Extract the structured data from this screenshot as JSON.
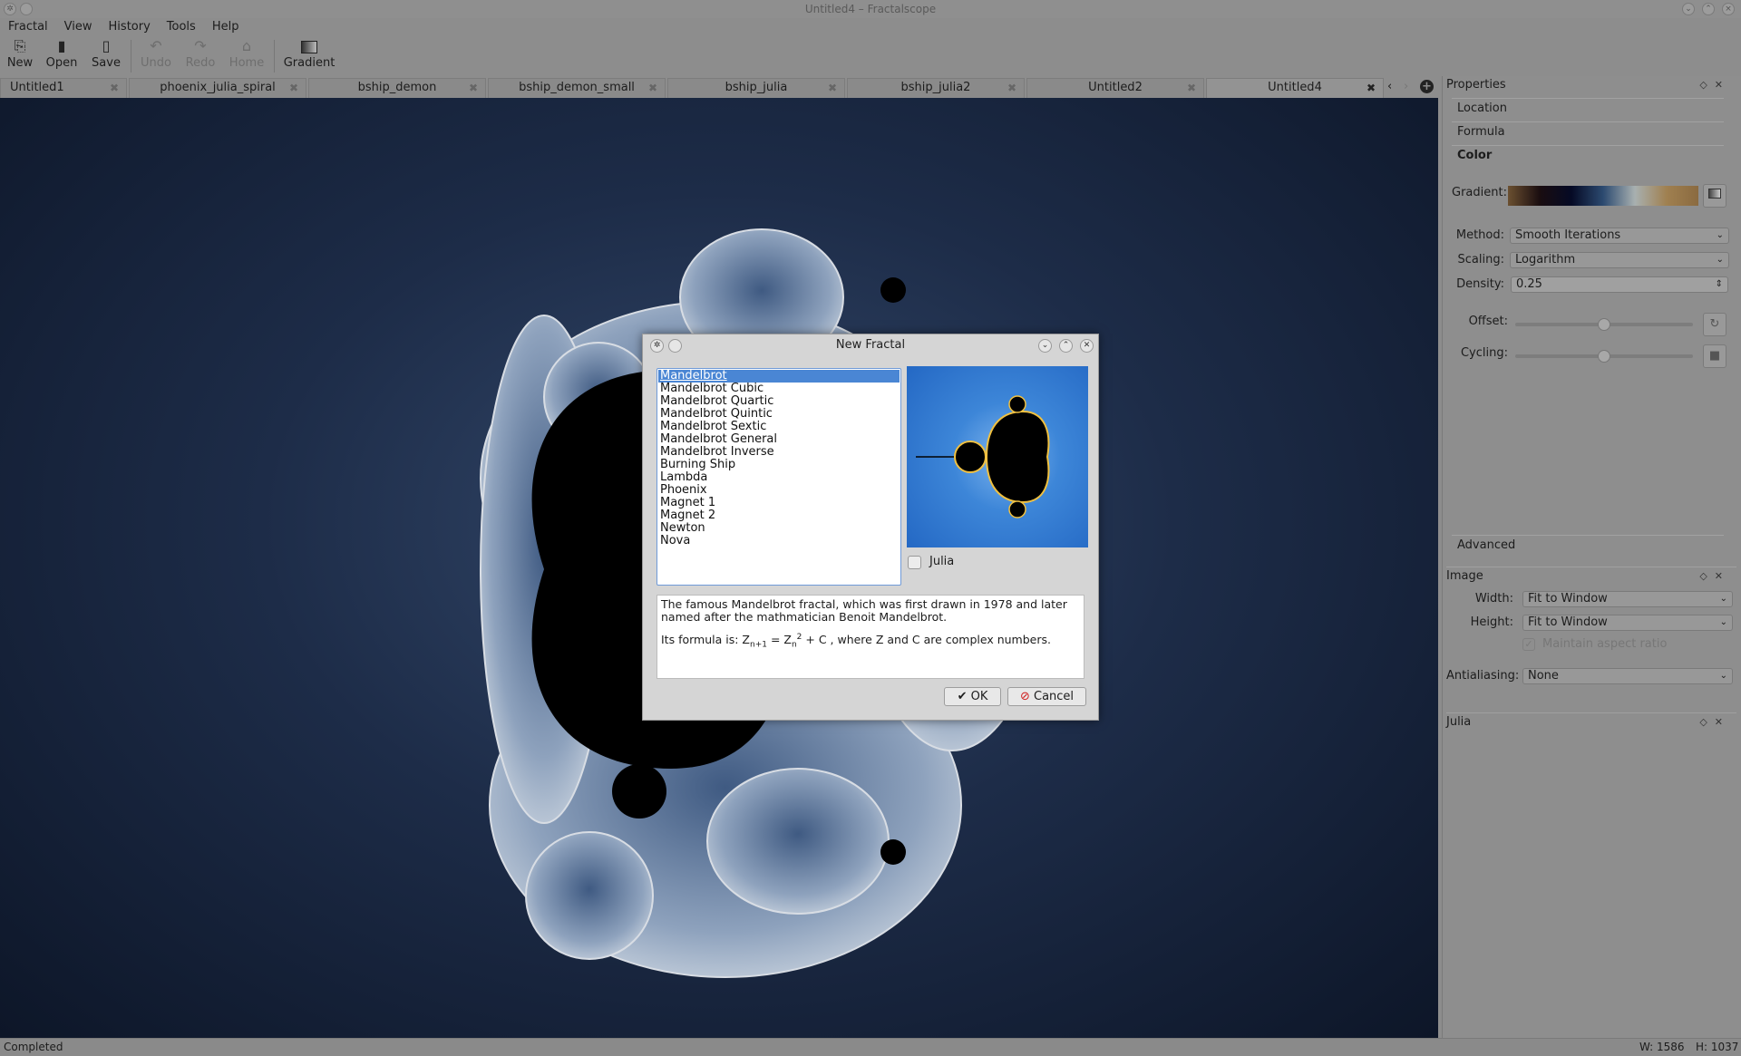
{
  "window": {
    "title": "Untitled4 – Fractalscope"
  },
  "menu": [
    "Fractal",
    "View",
    "History",
    "Tools",
    "Help"
  ],
  "toolbar": {
    "new": "New",
    "open": "Open",
    "save": "Save",
    "undo": "Undo",
    "redo": "Redo",
    "home": "Home",
    "gradient": "Gradient"
  },
  "tabs": [
    "Untitled1",
    "phoenix_julia_spiral",
    "bship_demon",
    "bship_demon_small",
    "bship_julia",
    "bship_julia2",
    "Untitled2",
    "Untitled4"
  ],
  "active_tab": "Untitled4",
  "status": {
    "text": "Completed",
    "width": "W: 1586",
    "height": "H: 1037"
  },
  "properties": {
    "title": "Properties",
    "sections": {
      "location": "Location",
      "formula": "Formula",
      "color": "Color",
      "advanced": "Advanced"
    },
    "gradient_label": "Gradient:",
    "gradient_colors": [
      "#6b5030",
      "#1a0d10",
      "#050a25",
      "#2c4a70",
      "#a8b0b0",
      "#a08050",
      "#8a6a40"
    ],
    "method_label": "Method:",
    "method": "Smooth Iterations",
    "scaling_label": "Scaling:",
    "scaling": "Logarithm",
    "density_label": "Density:",
    "density": "0.25",
    "offset_label": "Offset:",
    "offset_value": 0.5,
    "cycling_label": "Cycling:",
    "cycling_value": 0.5
  },
  "image": {
    "title": "Image",
    "width_label": "Width:",
    "width": "Fit to Window",
    "height_label": "Height:",
    "height": "Fit to Window",
    "aspect_label": "Maintain aspect ratio",
    "aspect_checked": true,
    "aa_label": "Antialiasing:",
    "aa": "None"
  },
  "julia_panel": {
    "title": "Julia"
  },
  "dialog": {
    "title": "New Fractal",
    "items": [
      "Mandelbrot",
      "Mandelbrot Cubic",
      "Mandelbrot Quartic",
      "Mandelbrot Quintic",
      "Mandelbrot Sextic",
      "Mandelbrot General",
      "Mandelbrot Inverse",
      "Burning Ship",
      "Lambda",
      "Phoenix",
      "Magnet 1",
      "Magnet 2",
      "Newton",
      "Nova"
    ],
    "selected": "Mandelbrot",
    "julia_label": "Julia",
    "julia_checked": false,
    "desc1": "The famous Mandelbrot fractal, which was first drawn in 1978 and later named after the mathmatician Benoit Mandelbrot.",
    "formula_prefix": "Its formula is: Z",
    "formula_sub1": "n+1",
    "formula_mid": " = Z",
    "formula_sub2": "n",
    "formula_sup": "2",
    "formula_suffix": " + C , where Z and C are complex numbers.",
    "ok": "OK",
    "cancel": "Cancel"
  }
}
